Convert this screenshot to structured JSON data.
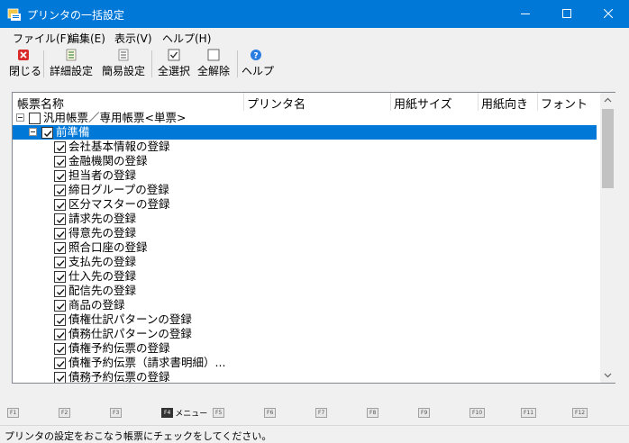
{
  "window": {
    "title": "プリンタの一括設定",
    "accent": "#0078d7"
  },
  "menu": [
    "ファイル(F)",
    "編集(E)",
    "表示(V)",
    "ヘルプ(H)"
  ],
  "toolbar": {
    "close": "閉じる",
    "detail": "詳細設定",
    "simple": "簡易設定",
    "select_all": "全選択",
    "deselect_all": "全解除",
    "help": "ヘルプ"
  },
  "columns": [
    "帳票名称",
    "プリンタ名",
    "用紙サイズ",
    "用紙向き",
    "フォント"
  ],
  "tree": {
    "root": "汎用帳票／専用帳票<単票>",
    "group": "前準備",
    "items": [
      "会社基本情報の登録",
      "金融機関の登録",
      "担当者の登録",
      "締日グループの登録",
      "区分マスターの登録",
      "請求先の登録",
      "得意先の登録",
      "照合口座の登録",
      "支払先の登録",
      "仕入先の登録",
      "配信先の登録",
      "商品の登録",
      "債権仕訳パターンの登録",
      "債務仕訳パターンの登録",
      "債権予約伝票の登録",
      "債権予約伝票（請求書明細）...",
      "債務予約伝票の登録"
    ]
  },
  "fkeys": [
    {
      "key": "F1",
      "label": ""
    },
    {
      "key": "F2",
      "label": ""
    },
    {
      "key": "F3",
      "label": ""
    },
    {
      "key": "F4",
      "label": "メニュー"
    },
    {
      "key": "F5",
      "label": ""
    },
    {
      "key": "F6",
      "label": ""
    },
    {
      "key": "F7",
      "label": ""
    },
    {
      "key": "F8",
      "label": ""
    },
    {
      "key": "F9",
      "label": ""
    },
    {
      "key": "F10",
      "label": ""
    },
    {
      "key": "F11",
      "label": ""
    },
    {
      "key": "F12",
      "label": ""
    }
  ],
  "status": "プリンタの設定をおこなう帳票にチェックをしてください。"
}
